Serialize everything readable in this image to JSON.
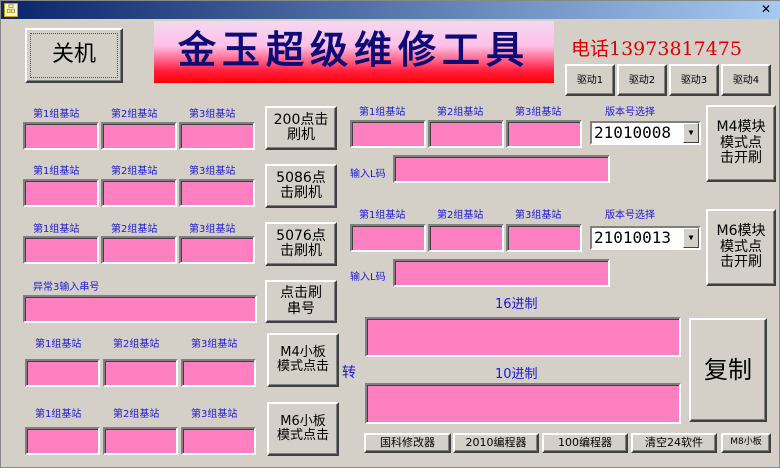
{
  "window": {
    "close_label": "✕"
  },
  "shutdown": "关机",
  "banner": "金玉超级维修工具",
  "phone": "电话13973817475",
  "drivers": [
    "驱动1",
    "驱动2",
    "驱动3",
    "驱动4"
  ],
  "station_labels": [
    "第1组基站",
    "第2组基站",
    "第3组基站"
  ],
  "serial_label": "异常3输入串号",
  "mid_buttons": {
    "b200": "200点击刷机",
    "b5086": "5086点击刷机",
    "b5076": "5076点击刷机",
    "serial": "点击刷串号",
    "m4small": "M4小板模式点击",
    "m6small": "M6小板模式点击"
  },
  "convert": "转",
  "version_label": "版本号选择",
  "m4": {
    "version": "21010008",
    "button": "M4模块模式点击开刷"
  },
  "m6": {
    "version": "21010013",
    "button": "M6模块模式点击开刷"
  },
  "lcode_label": "输入L码",
  "hex_label": "16进制",
  "dec_label": "10进制",
  "copy": "复制",
  "bottom_buttons": [
    "国科修改器",
    "2010编程器",
    "100编程器",
    "清空24软件",
    "M8小板"
  ]
}
